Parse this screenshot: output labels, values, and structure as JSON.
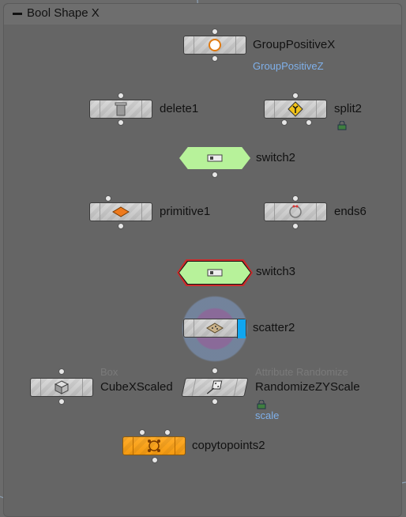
{
  "network_box": {
    "title": "Bool Shape X"
  },
  "nodes": {
    "group_positive_x": {
      "label": "GroupPositiveX",
      "sublabel": "GroupPositiveZ"
    },
    "delete1": {
      "label": "delete1"
    },
    "split2": {
      "label": "split2"
    },
    "switch2": {
      "label": "switch2"
    },
    "primitive1": {
      "label": "primitive1"
    },
    "ends6": {
      "label": "ends6"
    },
    "switch3": {
      "label": "switch3"
    },
    "scatter2": {
      "label": "scatter2"
    },
    "cube": {
      "label": "CubeXScaled",
      "type": "Box"
    },
    "randomize": {
      "label": "RandomizeZYScale",
      "type": "Attribute Randomize",
      "sublabel": "scale"
    },
    "copytopoints2": {
      "label": "copytopoints2"
    }
  },
  "colors": {
    "background": "#6b6b6b",
    "wire": "#8fa3b8",
    "switch_node": "#b7f29a",
    "display_node": "#f49a10",
    "render_flag": "#10a6f0",
    "selected_outline": "#cc2b2b",
    "group_text": "#7fb0ea"
  },
  "icons": {
    "group_positive_x": "ring-icon",
    "delete1": "trash-icon",
    "split2": "split-icon",
    "switch2": "switch-icon",
    "primitive1": "diamond-icon",
    "ends6": "ring-icon",
    "switch3": "switch-icon",
    "scatter2": "scatter-icon",
    "cube": "cube-icon",
    "randomize": "dice-icon",
    "copytopoints2": "copy-points-icon"
  }
}
